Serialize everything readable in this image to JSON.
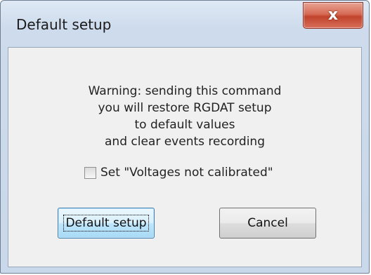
{
  "window": {
    "title": "Default setup",
    "close_symbol": "x"
  },
  "message": {
    "lines": [
      "Warning: sending this command",
      "you will restore RGDAT setup",
      "to default values",
      "and clear events recording"
    ]
  },
  "checkbox": {
    "label": "Set \"Voltages not calibrated\"",
    "checked": false
  },
  "buttons": {
    "default_label": "Default setup",
    "cancel_label": "Cancel"
  },
  "colors": {
    "accent": "#3c7fb1",
    "close": "#c1432c"
  }
}
